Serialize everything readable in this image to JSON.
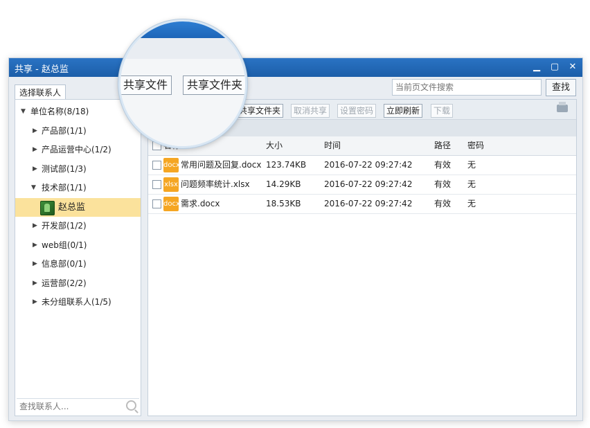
{
  "window": {
    "title": "共享 - 赵总监",
    "minimize": "▁",
    "maximize": "▢",
    "close": "✕"
  },
  "left_tab": "选择联系人",
  "tree": {
    "root": "单位名称(8/18)",
    "groups": [
      "产品部(1/1)",
      "产品运营中心(1/2)",
      "测试部(1/3)",
      "技术部(1/1)"
    ],
    "contact": "赵总监",
    "groups2": [
      "开发部(1/2)",
      "web组(0/1)",
      "信息部(0/1)",
      "运营部(2/2)",
      "未分组联系人(1/5)"
    ]
  },
  "contact_search_placeholder": "查找联系人...",
  "top_search": {
    "placeholder": "当前页文件搜索",
    "button": "查找"
  },
  "toolbar": {
    "share_file": "共享文件",
    "share_folder": "共享文件夹",
    "cancel_share": "取消共享",
    "set_password": "设置密码",
    "refresh": "立即刷新",
    "download": "下载"
  },
  "table": {
    "headers": {
      "name": "名称",
      "size": "大小",
      "time": "时间",
      "path": "路径",
      "password": "密码"
    },
    "rows": [
      {
        "type": "docx",
        "name": "常用问题及回复.docx",
        "size": "123.74KB",
        "time": "2016-07-22 09:27:42",
        "path": "有效",
        "password": "无"
      },
      {
        "type": "xlsx",
        "name": "问题频率统计.xlsx",
        "size": "14.29KB",
        "time": "2016-07-22 09:27:42",
        "path": "有效",
        "password": "无"
      },
      {
        "type": "docx",
        "name": "需求.docx",
        "size": "18.53KB",
        "time": "2016-07-22 09:27:42",
        "path": "有效",
        "password": "无"
      }
    ]
  },
  "zoom": {
    "share_file": "共享文件",
    "share_folder": "共享文件夹"
  }
}
